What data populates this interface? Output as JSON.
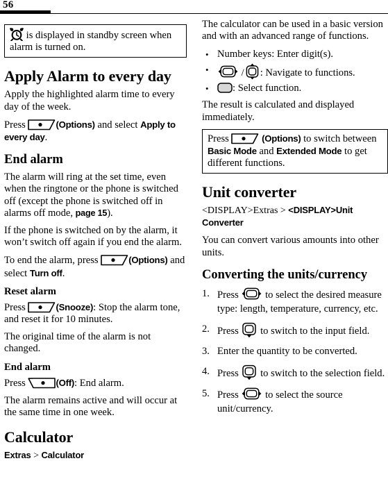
{
  "page": {
    "number": "56"
  },
  "left_column": {
    "note_alarm": {
      "icon": "alarm-clock-icon",
      "text_after_icon": " is displayed in standby screen when alarm is turned on."
    },
    "heading_apply": "Apply Alarm to every day",
    "apply_p1": "Apply the highlighted alarm time to every day of the week.",
    "apply_p2_press": "Press ",
    "apply_p2_options": "(Options)",
    "apply_p2_and_select": " and select ",
    "apply_p2_cmd": "Apply to every day",
    "apply_p2_end": ".",
    "heading_end_alarm": "End alarm",
    "end_p1_a": "The alarm will ring at the set time, even when the ringtone or the phone is switched off (except the phone is switched off in alarms off mode, ",
    "end_p1_xref": "page 15",
    "end_p1_b": ").",
    "end_p2": "If the phone is switched on by the alarm, it won’t switch off again if you end the alarm.",
    "end_p3_a": "To end the alarm, press ",
    "end_p3_options": "(Options)",
    "end_p3_b": " and select ",
    "end_p3_cmd": "Turn off",
    "end_p3_c": ".",
    "heading_reset_alarm": "Reset alarm",
    "reset_p1_a": "Press ",
    "reset_p1_snooze": "(Snooze)",
    "reset_p1_b": ": Stop the alarm tone, and reset it for 10 minutes.",
    "reset_p2": "The original time of the alarm is not changed.",
    "heading_end_alarm_2": "End alarm",
    "end2_p1_a": "Press ",
    "end2_p1_off": "(Off)",
    "end2_p1_b": ": End alarm.",
    "end2_p2": "The alarm remains active and will occur at the same time in one week.",
    "heading_calculator": "Calculator",
    "calculator_breadcrumb_a": "Extras",
    "calculator_breadcrumb_sep": " > ",
    "calculator_breadcrumb_b": "Calculator"
  },
  "right_column": {
    "calc_p1": "The calculator can be used in a basic version and with an advanced range of functions.",
    "bullets": [
      {
        "text": "Number keys: Enter digit(s).",
        "icon": null
      },
      {
        "text": ": Navigate to functions.",
        "icon": "nav-keys-lr-ud"
      },
      {
        "text": ": Select function.",
        "icon": "select-key"
      }
    ],
    "calc_p2": "The result is calculated and displayed immediately.",
    "note_modes": {
      "press": "Press ",
      "options": "(Options)",
      "to_switch": " to switch between ",
      "mode_basic": "Basic Mode",
      "and": " and ",
      "mode_extended": "Extended Mode",
      "to_get": " to get different functions."
    },
    "heading_unit_converter": "Unit converter",
    "uc_breadcrumb_a": "<DISPLAY>Extras",
    "uc_breadcrumb_sep": " > ",
    "uc_breadcrumb_b": "<DISPLAY>Unit Converter",
    "uc_p1": "You can convert various amounts into other units.",
    "heading_converting": "Converting the units/currency",
    "steps": [
      {
        "pre": "Press ",
        "icon": "nav-key-lr",
        "post": " to select the desired measure type: length, temperature, currency, etc."
      },
      {
        "pre": "Press ",
        "icon": "nav-key-down",
        "post": " to switch to the input field."
      },
      {
        "pre": "Enter the quantity to be converted.",
        "icon": null,
        "post": ""
      },
      {
        "pre": "Press ",
        "icon": "nav-key-down",
        "post": " to switch to the selection field."
      },
      {
        "pre": "Press ",
        "icon": "nav-key-lr",
        "post": " to select the source unit/currency."
      }
    ]
  },
  "colors": {
    "text": "#000000",
    "rule": "#000000",
    "key_fill": "#d8d8d8",
    "page_bg": "#ffffff"
  }
}
